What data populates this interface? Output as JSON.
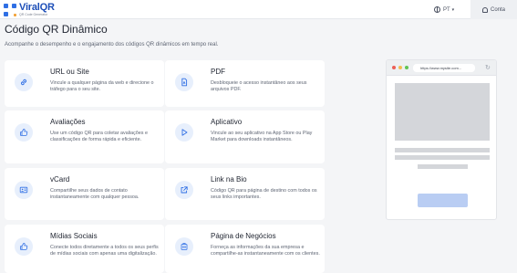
{
  "header": {
    "brand": "ViralQR",
    "brand_tagline": "QR Code Generator",
    "language": "PT",
    "account_label": "Conta"
  },
  "page": {
    "title": "Código QR Dinâmico",
    "subtitle": "Acompanhe o desempenho e o engajamento dos códigos QR dinâmicos em tempo real."
  },
  "cards": [
    {
      "icon": "link-icon",
      "title": "URL ou Site",
      "description": "Vincule a qualquer página da web e direcione o tráfego para o seu site."
    },
    {
      "icon": "pdf-file-icon",
      "title": "PDF",
      "description": "Desbloqueie o acesso instantâneo aos seus arquivos PDF."
    },
    {
      "icon": "thumbs-up-icon",
      "title": "Avaliações",
      "description": "Use um código QR para coletar avaliações e classificações de forma rápida e eficiente."
    },
    {
      "icon": "play-icon",
      "title": "Aplicativo",
      "description": "Vincule ao seu aplicativo na App Store ou Play Market para downloads instantâneos."
    },
    {
      "icon": "id-card-icon",
      "title": "vCard",
      "description": "Compartilhe seus dados de contato instantaneamente com qualquer pessoa."
    },
    {
      "icon": "external-link-icon",
      "title": "Link na Bio",
      "description": "Código QR para página de destino com todos os seus links importantes."
    },
    {
      "icon": "thumbs-up-icon",
      "title": "Mídias Sociais",
      "description": "Conecte todos diretamente a todos os seus perfis de mídias sociais com apenas uma digitalização."
    },
    {
      "icon": "building-icon",
      "title": "Página de Negócios",
      "description": "Forneça as informações da sua empresa e compartilhe-as instantaneamente com os clientes."
    }
  ],
  "preview": {
    "url": "https://www.mysite.com..."
  },
  "colors": {
    "accent": "#2f6fe4",
    "icon_bg": "#e7effc",
    "background": "#f4f5f7",
    "preview_button": "#b9cdf3",
    "dot_red": "#ec5f56",
    "dot_yellow": "#f4bd4f",
    "dot_green": "#61c454"
  }
}
